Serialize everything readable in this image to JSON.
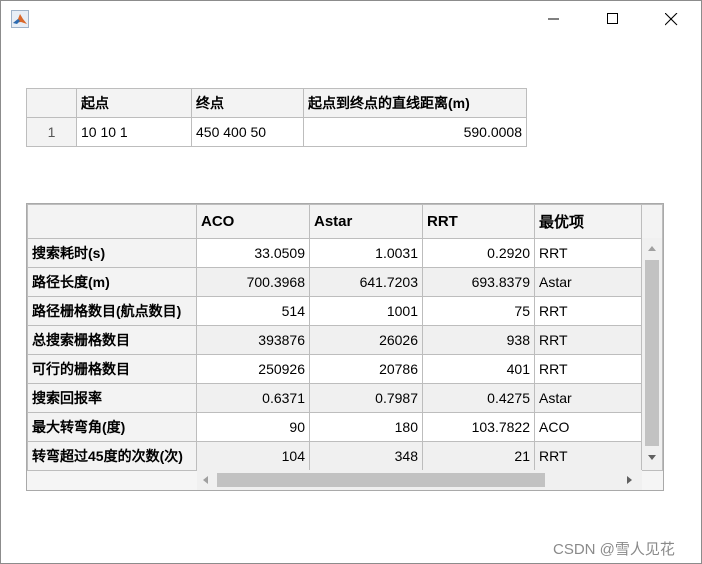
{
  "window": {
    "controls": {
      "minimize": "minimize",
      "maximize": "maximize",
      "close": "close"
    }
  },
  "table1": {
    "headers": [
      "",
      "起点",
      "终点",
      "起点到终点的直线距离(m)"
    ],
    "rows": [
      {
        "index": "1",
        "start": "10 10 1",
        "end": "450 400 50",
        "distance": "590.0008"
      }
    ]
  },
  "table2": {
    "headers": [
      "",
      "ACO",
      "Astar",
      "RRT",
      "最优项"
    ],
    "rows": [
      {
        "label": "搜索耗时(s)",
        "aco": "33.0509",
        "astar": "1.0031",
        "rrt": "0.2920",
        "best": "RRT"
      },
      {
        "label": "路径长度(m)",
        "aco": "700.3968",
        "astar": "641.7203",
        "rrt": "693.8379",
        "best": "Astar"
      },
      {
        "label": "路径栅格数目(航点数目)",
        "aco": "514",
        "astar": "1001",
        "rrt": "75",
        "best": "RRT"
      },
      {
        "label": "总搜索栅格数目",
        "aco": "393876",
        "astar": "26026",
        "rrt": "938",
        "best": "RRT"
      },
      {
        "label": "可行的栅格数目",
        "aco": "250926",
        "astar": "20786",
        "rrt": "401",
        "best": "RRT"
      },
      {
        "label": "搜索回报率",
        "aco": "0.6371",
        "astar": "0.7987",
        "rrt": "0.4275",
        "best": "Astar"
      },
      {
        "label": "最大转弯角(度)",
        "aco": "90",
        "astar": "180",
        "rrt": "103.7822",
        "best": "ACO"
      },
      {
        "label": "转弯超过45度的次数(次)",
        "aco": "104",
        "astar": "348",
        "rrt": "21",
        "best": "RRT"
      }
    ]
  },
  "watermark": "CSDN @雪人见花"
}
